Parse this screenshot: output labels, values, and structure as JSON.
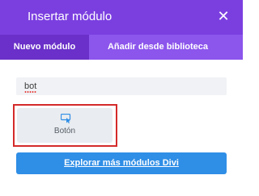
{
  "header": {
    "title": "Insertar módulo",
    "close_icon": "close-icon"
  },
  "tabs": [
    {
      "label": "Nuevo módulo",
      "active": true
    },
    {
      "label": "Añadir desde biblioteca",
      "active": false
    }
  ],
  "search": {
    "value": "bot"
  },
  "results": [
    {
      "label": "Botón",
      "icon": "button-cursor-icon",
      "highlighted": true
    }
  ],
  "explore_button": {
    "label": "Explorar más módulos Divi"
  },
  "colors": {
    "header": "#7b3fe0",
    "tabs_bar": "#8c55ec",
    "active_tab": "#6a30c9",
    "primary_button": "#2f8ee6",
    "highlight": "#d42a2a"
  }
}
